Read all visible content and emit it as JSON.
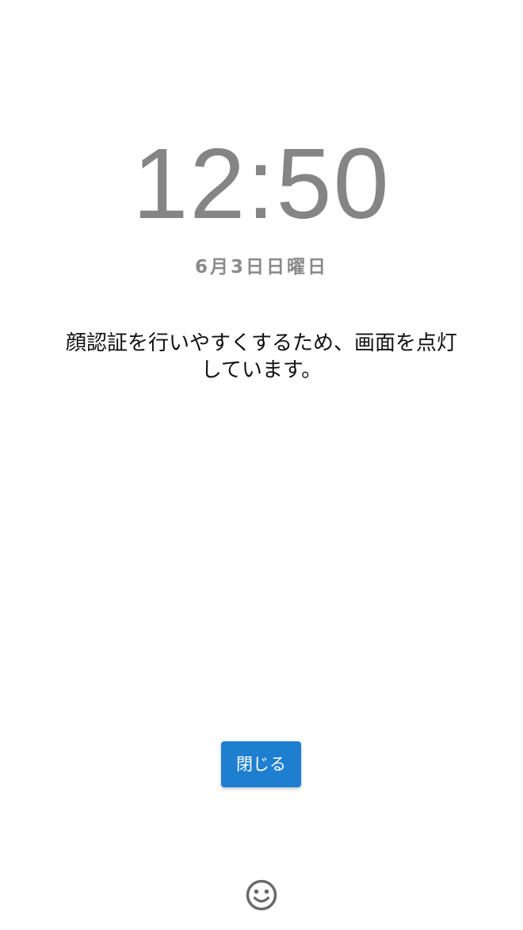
{
  "lockscreen": {
    "time": "12:50",
    "date": "6月3日日曜日",
    "message": "顔認証を行いやすくするため、画面を点灯しています。",
    "close_label": "閉じる",
    "face_icon": "face-smile-icon"
  },
  "colors": {
    "background": "#ffffff",
    "clock_text": "#858585",
    "date_text": "#8a8a8a",
    "message_text": "#111111",
    "button_bg": "#1e7fd0",
    "button_text": "#ffffff",
    "icon": "#6a6a6a"
  }
}
